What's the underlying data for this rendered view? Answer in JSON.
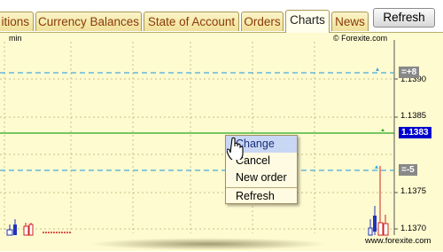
{
  "tabs": [
    {
      "label": "itions"
    },
    {
      "label": "Currency Balances"
    },
    {
      "label": "State of Account"
    },
    {
      "label": "Orders"
    },
    {
      "label": "Charts"
    },
    {
      "label": "News"
    }
  ],
  "toolbar": {
    "refresh_label": "Refresh"
  },
  "chart": {
    "timeframe_label": "min",
    "copyright": "© Forexite.com",
    "price_ticks": [
      "1.1390",
      "1.1385",
      "1.1375",
      "1.1370"
    ],
    "current_price": "1.1383",
    "upper_level_tag": "=+8",
    "lower_level_tag": "=-5",
    "colors": {
      "current_price_line": "#22aa22",
      "level_line": "#44aadd",
      "price_tag_bg": "#0000cc",
      "level_tag_bg": "#888888"
    }
  },
  "context_menu": {
    "items": [
      {
        "label": "Change",
        "highlighted": true
      },
      {
        "label": "Cancel"
      },
      {
        "label": "New order"
      },
      {
        "label": "Refresh"
      }
    ]
  },
  "footer": {
    "site": "www.forexite.com"
  }
}
